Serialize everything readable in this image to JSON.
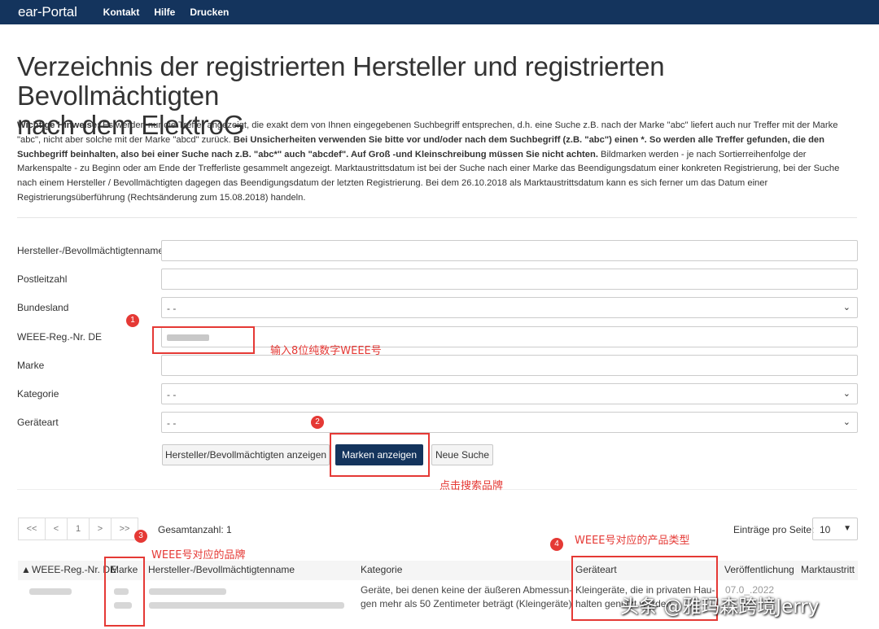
{
  "nav": {
    "brand": "ear-Portal",
    "links": [
      "Kontakt",
      "Hilfe",
      "Drucken"
    ]
  },
  "page_title_line1": "Verzeichnis der registrierten Hersteller und registrierten Bevollmächtigten",
  "page_title_line2": "nach dem ElektroG",
  "notice": {
    "label": "Wichtige Hinweise:",
    "text1": " Es werden nur die Treffer angezeigt, die exakt dem von Ihnen eingegebenen Suchbegriff entsprechen, d.h. eine Suche z.B. nach der Marke \"abc\" liefert auch nur Treffer mit der Marke \"abc\", nicht aber solche mit der Marke \"abcd\" zurück. ",
    "bold": "Bei Unsicherheiten verwenden Sie bitte vor und/oder nach dem Suchbegriff (z.B. \"abc\") einen *. So werden alle Treffer gefunden, die den Suchbegriff beinhalten, also bei einer Suche nach z.B. \"abc*\" auch \"abcdef\". Auf Groß -und Kleinschreibung müssen Sie nicht achten.",
    "text2": " Bildmarken werden - je nach Sortierreihenfolge der Markenspalte - zu Beginn oder am Ende der Trefferliste gesammelt angezeigt. Marktaustrittsdatum ist bei der Suche nach einer Marke das Beendigungsdatum einer konkreten Registrierung, bei der Suche nach einem Hersteller / Bevollmächtigten dagegen das Beendigungsdatum der letzten Registrierung. Bei dem 26.10.2018 als Marktaustrittsdatum kann es sich ferner um das Datum einer Registrierungsüberführung (Rechtsänderung zum 15.08.2018) handeln."
  },
  "form": {
    "hersteller_label": "Hersteller-/Bevollmächtigtenname",
    "plz_label": "Postleitzahl",
    "bundesland_label": "Bundesland",
    "bundesland_value": "- -",
    "weee_label": "WEEE-Reg.-Nr. DE",
    "marke_label": "Marke",
    "kategorie_label": "Kategorie",
    "kategorie_value": "- -",
    "geraeteart_label": "Geräteart",
    "geraeteart_value": "- -"
  },
  "buttons": {
    "hersteller": "Hersteller/Bevollmächtigten anzeigen",
    "marken": "Marken anzeigen",
    "neue_suche": "Neue Suche"
  },
  "pager": {
    "first": "<<",
    "prev": "<",
    "page": "1",
    "next": ">",
    "last": ">>",
    "total": "Gesamtanzahl: 1",
    "per_page_label": "Einträge pro Seite:",
    "per_page_value": "10"
  },
  "table": {
    "headers": [
      "WEEE-Reg.-Nr. DE",
      "Marke",
      "Hersteller-/Bevollmächtigtenname",
      "Kategorie",
      "Geräteart",
      "Veröffentlichung",
      "Marktaustritt"
    ],
    "row": {
      "kategorie_line1": "Geräte, bei denen keine der äußeren Abmessun-",
      "kategorie_line2": "gen mehr als 50 Zentimeter beträgt (Kleingeräte)",
      "geraeteart_line1": "Kleingeräte, die in privaten Hau-",
      "geraeteart_line2": "halten genutzt werden",
      "date_partial": "07.0_.2022"
    }
  },
  "annotations": {
    "n1": "1",
    "n2": "2",
    "n3": "3",
    "n4": "4",
    "t1": "输入8位纯数字WEEE号",
    "t2": "点击搜索品牌",
    "t3": "WEEE号对应的品牌",
    "t4": "WEEE号对应的产品类型"
  },
  "watermark": "头条 @雅玛森跨境Jerry",
  "colors": {
    "navbar": "#14345d",
    "primary_button": "#14345d",
    "annotation": "#e53935"
  }
}
